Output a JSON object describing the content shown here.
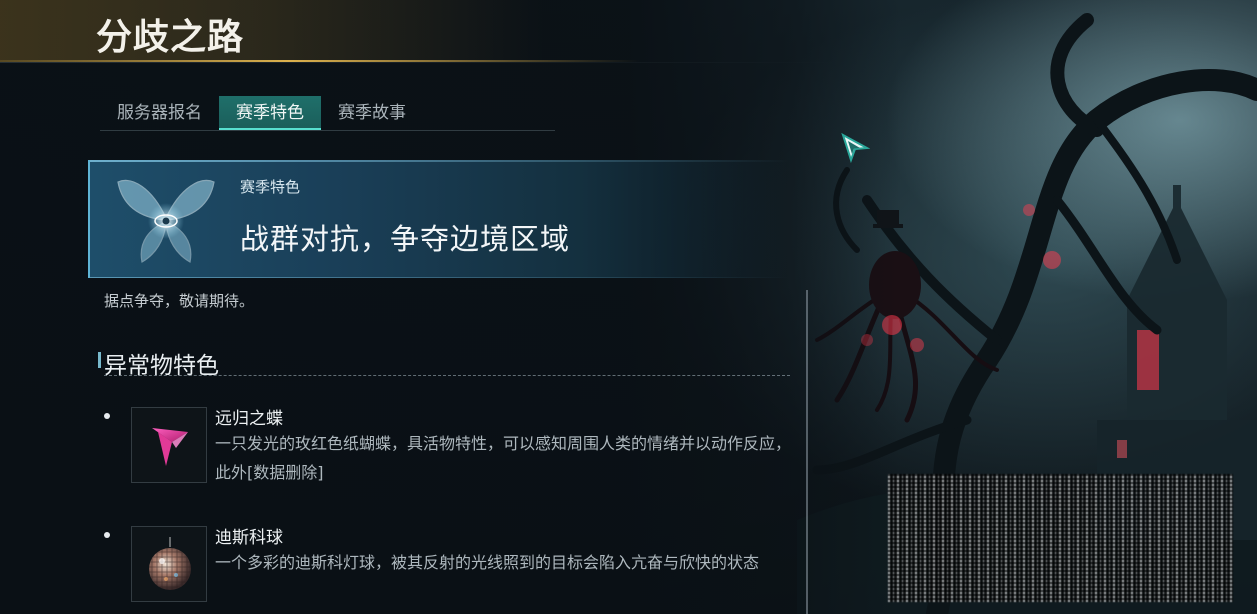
{
  "header": {
    "title": "分歧之路"
  },
  "tabs": [
    {
      "label": "服务器报名",
      "active": false
    },
    {
      "label": "赛季特色",
      "active": true
    },
    {
      "label": "赛季故事",
      "active": false
    }
  ],
  "banner": {
    "kicker": "赛季特色",
    "headline": "战群对抗，争夺边境区域",
    "icon": "butterfly-eye-icon"
  },
  "description": "据点争夺，敬请期待。",
  "anomaly_section": {
    "title": "异常物特色",
    "items": [
      {
        "name": "远归之蝶",
        "text": "一只发光的玫红色纸蝴蝶，具活物特性，可以感知周围人类的情绪并以动作反应，此外[数据删除]",
        "icon": "pink-paper-butterfly-icon"
      },
      {
        "name": "迪斯科球",
        "text": "一个多彩的迪斯科灯球，被其反射的光线照到的目标会陷入亢奋与欣快的状态",
        "icon": "disco-ball-icon"
      }
    ]
  },
  "colors": {
    "accent_teal": "#1f6f6a",
    "tab_underline": "#58e0d0",
    "banner_blue": "#1e4e6a",
    "gold": "#e6b950",
    "glow_red": "#ff3b4f"
  }
}
